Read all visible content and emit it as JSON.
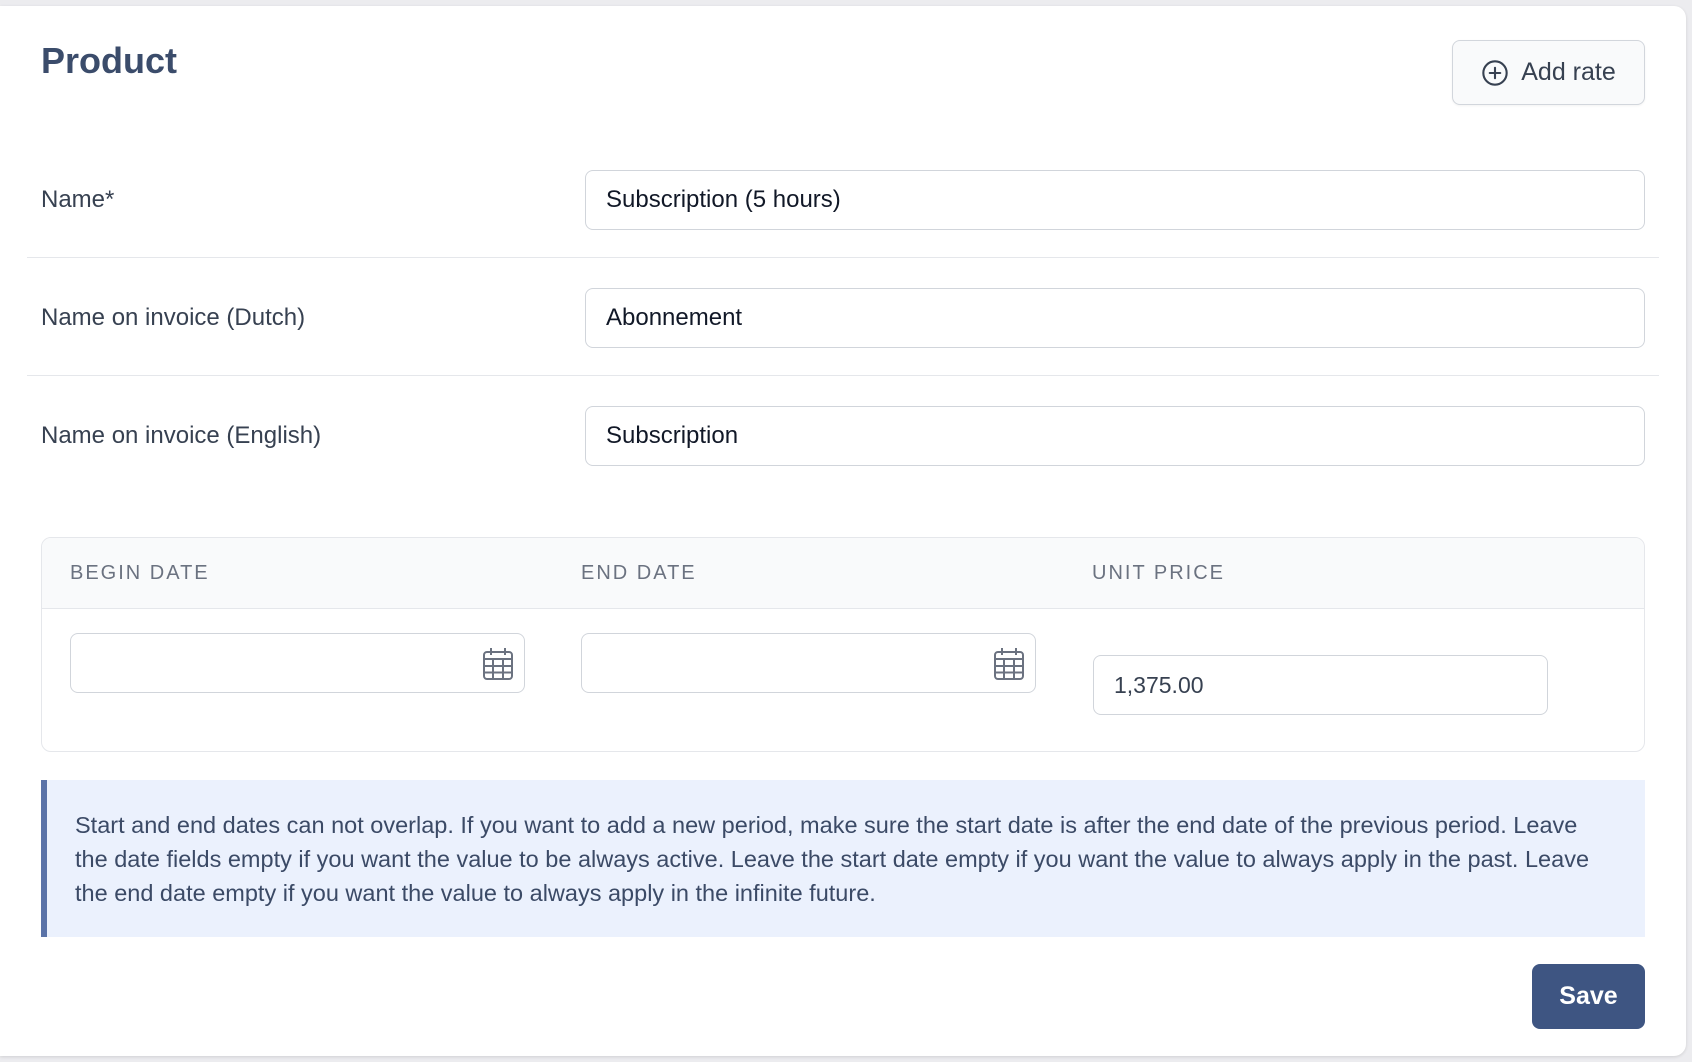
{
  "page": {
    "title": "Product"
  },
  "actions": {
    "add_rate_label": "Add rate",
    "save_label": "Save"
  },
  "fields": [
    {
      "label": "Name*",
      "value": "Subscription (5 hours)"
    },
    {
      "label": "Name on invoice (Dutch)",
      "value": "Abonnement"
    },
    {
      "label": "Name on invoice (English)",
      "value": "Subscription"
    }
  ],
  "rates": {
    "columns": [
      "BEGIN DATE",
      "END DATE",
      "UNIT PRICE"
    ],
    "rows": [
      {
        "begin_date": "",
        "end_date": "",
        "unit_price": "1,375.00"
      }
    ]
  },
  "info": {
    "text": "Start and end dates can not overlap. If you want to add a new period, make sure the start date is after the end date of the previous period. Leave the date fields empty if you want the value to be always active. Leave the start date empty if you want the value to always apply in the past. Leave the end date empty if you want the value to always apply in the infinite future."
  },
  "icons": {
    "add_rate": "plus-circle-icon",
    "date_picker": "calendar-icon"
  },
  "colors": {
    "primary": "#3e5582",
    "title": "#3b4c6b",
    "info_background": "#ebf1fd",
    "info_border": "#5a73a8"
  }
}
